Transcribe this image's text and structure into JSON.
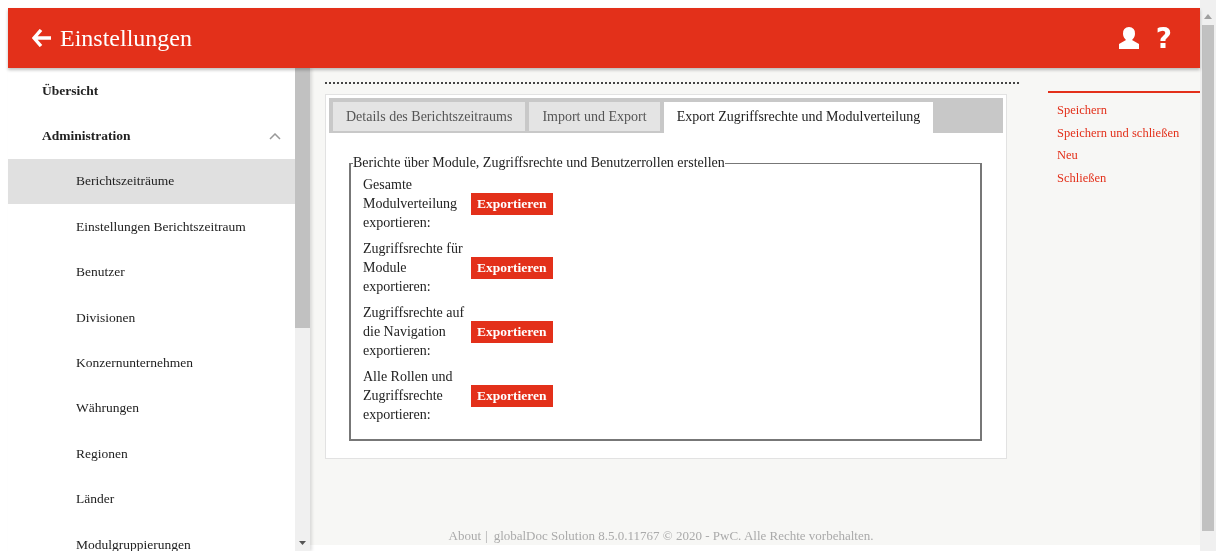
{
  "header": {
    "title": "Einstellungen",
    "help": "?"
  },
  "sidebar": {
    "items": [
      {
        "label": "Übersicht",
        "selected": false
      },
      {
        "label": "Administration",
        "selected": false,
        "expanded": true,
        "children": [
          {
            "label": "Berichtszeiträume",
            "selected": true
          },
          {
            "label": "Einstellungen Berichtszeitraum",
            "selected": false
          },
          {
            "label": "Benutzer",
            "selected": false
          },
          {
            "label": "Divisionen",
            "selected": false
          },
          {
            "label": "Konzernunternehmen",
            "selected": false
          },
          {
            "label": "Währungen",
            "selected": false
          },
          {
            "label": "Regionen",
            "selected": false
          },
          {
            "label": "Länder",
            "selected": false
          },
          {
            "label": "Modulgruppierungen",
            "selected": false
          }
        ]
      }
    ]
  },
  "tabs": [
    {
      "label": "Details des Berichtszeitraums",
      "selected": false
    },
    {
      "label": "Import und Export",
      "selected": false
    },
    {
      "label": "Export Zugriffsrechte und Modulverteilung",
      "selected": true
    }
  ],
  "fieldset": {
    "legend": "Berichte über Module, Zugriffsrechte und Benutzerrollen erstellen",
    "rows": [
      {
        "label": "Gesamte Modulverteilung exportieren:",
        "button": "Exportieren"
      },
      {
        "label": "Zugriffsrechte für Module exportieren:",
        "button": "Exportieren"
      },
      {
        "label": "Zugriffsrechte auf die Navigation exportieren:",
        "button": "Exportieren"
      },
      {
        "label": "Alle Rollen und Zugriffsrechte exportieren:",
        "button": "Exportieren"
      }
    ]
  },
  "actions": [
    "Speichern",
    "Speichern und schließen",
    "Neu",
    "Schließen"
  ],
  "footer": {
    "about": "About",
    "separator": "|",
    "text": "globalDoc Solution 8.5.0.11767  © 2020 - PwC. Alle Rechte vorbehalten."
  }
}
